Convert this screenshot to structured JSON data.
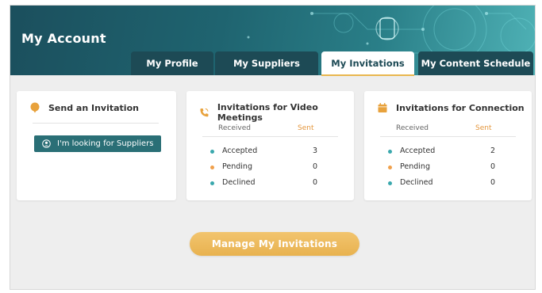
{
  "header": {
    "title": "My Account"
  },
  "tabs": [
    {
      "label": "My Profile"
    },
    {
      "label": "My Suppliers"
    },
    {
      "label": "My Invitations"
    },
    {
      "label": "My Content Schedule"
    }
  ],
  "send_card": {
    "title": "Send an Invitation",
    "button_label": "I'm looking for Suppliers"
  },
  "video_card": {
    "title": "Invitations for Video Meetings",
    "received_label": "Received",
    "sent_label": "Sent",
    "rows": [
      {
        "label": "Accepted",
        "value": "3"
      },
      {
        "label": "Pending",
        "value": "0"
      },
      {
        "label": "Declined",
        "value": "0"
      }
    ]
  },
  "connection_card": {
    "title": "Invitations for Connection",
    "received_label": "Received",
    "sent_label": "Sent",
    "rows": [
      {
        "label": "Accepted",
        "value": "2"
      },
      {
        "label": "Pending",
        "value": "0"
      },
      {
        "label": "Declined",
        "value": "0"
      }
    ]
  },
  "manage_button": {
    "label": "Manage My Invitations"
  },
  "colors": {
    "accent": "#e9b64e",
    "teal": "#2a6f76",
    "tab_dark": "#1d4a55",
    "accepted_dot": "#3aa8ad",
    "pending_dot": "#f0a04b",
    "declined_dot": "#3aa8ad"
  }
}
